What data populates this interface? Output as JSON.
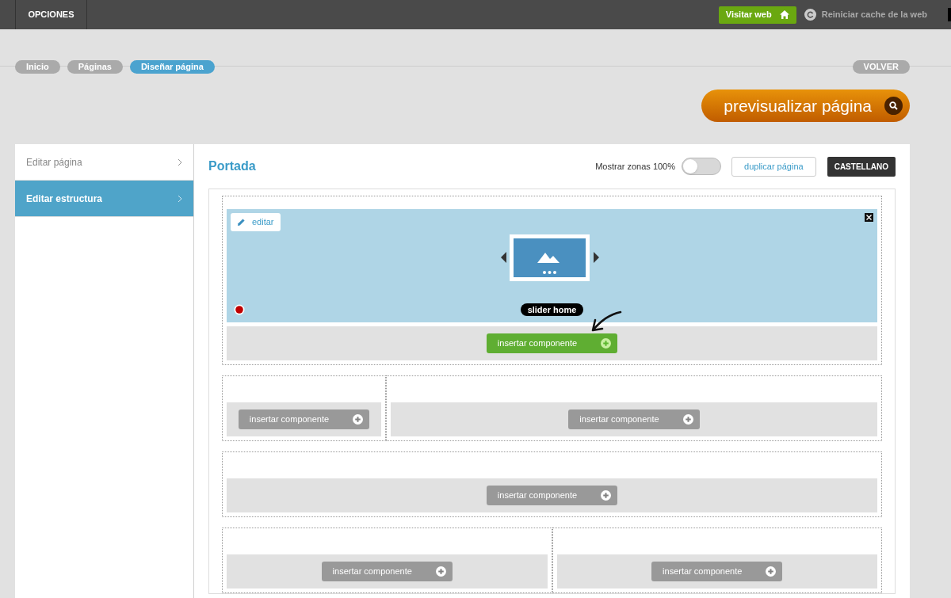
{
  "topbar": {
    "menu": "OPCIONES",
    "visit_button": "Visitar web",
    "cache_link": "Reiniciar cache de la web"
  },
  "breadcrumbs": [
    {
      "label": "Inicio",
      "selected": false
    },
    {
      "label": "Páginas",
      "selected": false
    },
    {
      "label": "Diseñar página",
      "selected": true
    }
  ],
  "back_button": "VOLVER",
  "preview_button": "previsualizar página",
  "sidebar": {
    "items": [
      {
        "label": "Editar página",
        "selected": false
      },
      {
        "label": "Editar estructura",
        "selected": true
      }
    ]
  },
  "page": {
    "title": "Portada",
    "zones_toggle": {
      "label": "Mostrar zonas 100%",
      "on": false
    },
    "duplicate_button": "duplicar página",
    "language_button": "CASTELLANO"
  },
  "rows": [
    {
      "kind": "full",
      "columns": [
        {
          "widget": {
            "edit_label": "editar",
            "name": "slider home"
          },
          "insert": {
            "label": "insertar componente",
            "highlighted": true
          }
        }
      ]
    },
    {
      "kind": "third",
      "columns": [
        {
          "insert": {
            "label": "insertar componente",
            "highlighted": false
          }
        },
        {
          "insert": {
            "label": "insertar componente",
            "highlighted": false
          }
        }
      ]
    },
    {
      "kind": "full",
      "columns": [
        {
          "insert": {
            "label": "insertar componente",
            "highlighted": false
          }
        }
      ]
    },
    {
      "kind": "half",
      "columns": [
        {
          "insert": {
            "label": "insertar componente",
            "highlighted": false
          }
        },
        {
          "insert": {
            "label": "insertar componente",
            "highlighted": false
          }
        }
      ]
    }
  ]
}
